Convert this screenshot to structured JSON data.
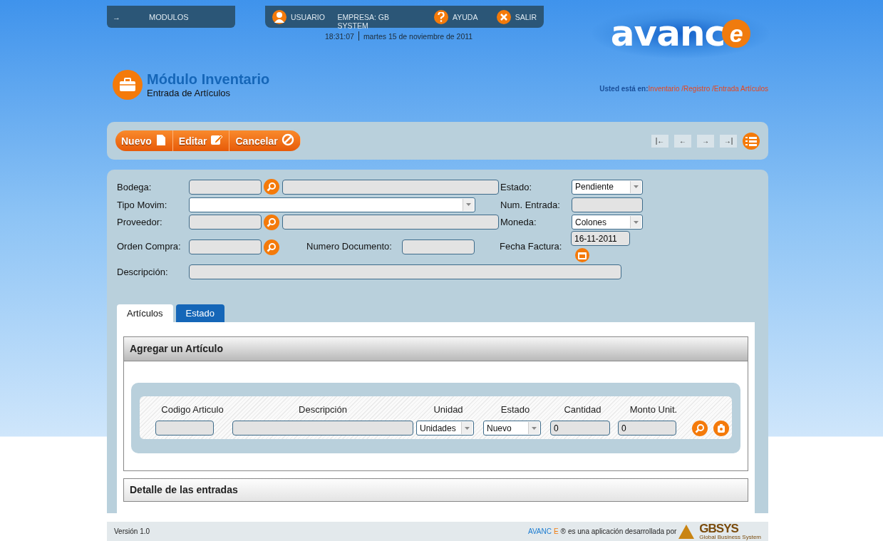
{
  "top_bar": {
    "modules_arrow": "→",
    "modules": "MODULOS",
    "user": "USUARIO",
    "company": "EMPRESA: GB SYSTEM",
    "help": "AYUDA",
    "exit": "SALIR"
  },
  "clock": {
    "time": "18:31:07",
    "date": "martes 15 de noviembre de 2011"
  },
  "logo": {
    "main": "avanc",
    "accent": "e"
  },
  "module": {
    "title": "Módulo Inventario",
    "subtitle": "Entrada de Artículos"
  },
  "breadcrumb": {
    "prefix": "Usted está en:",
    "items": [
      "Inventario /",
      "Registro /",
      "Entrada Artículos"
    ]
  },
  "toolbar": {
    "buttons": [
      {
        "label": "Nuevo",
        "kind": "new"
      },
      {
        "label": "Editar",
        "kind": "edit"
      },
      {
        "label": "Cancelar",
        "kind": "cancel"
      }
    ],
    "nav": [
      "|←",
      "←",
      "→",
      "→|"
    ]
  },
  "form": {
    "bodega": "Bodega:",
    "estado": "Estado:",
    "estado_value": "Pendiente",
    "tipo": "Tipo Movim:",
    "num_entrada": "Num. Entrada:",
    "proveedor": "Proveedor:",
    "moneda": "Moneda:",
    "moneda_value": "Colones",
    "orden": "Orden Compra:",
    "numero_doc": "Numero Documento:",
    "fecha": "Fecha Factura:",
    "fecha_value": "16-11-2011",
    "descripcion": "Descripción:"
  },
  "tabs": [
    {
      "label": "Artículos",
      "selected": true
    },
    {
      "label": "Estado",
      "selected": false
    }
  ],
  "add_section": {
    "title": "Agregar un Artículo",
    "columns": [
      "Codigo Articulo",
      "Descripción",
      "Unidad",
      "Estado",
      "Cantidad",
      "Monto Unit."
    ],
    "unidad": "Unidades",
    "estado": "Nuevo",
    "cantidad": "0",
    "monto": "0"
  },
  "detail_section": {
    "title": "Detalle de las entradas"
  },
  "footer": {
    "version": "Versión 1.0",
    "brand_main": "AVANC",
    "brand_accent": "E",
    "mark": "®",
    "tagline": "es una aplicación desarrollada por",
    "company": "GBSYS",
    "company_sub": "Global Business System"
  }
}
